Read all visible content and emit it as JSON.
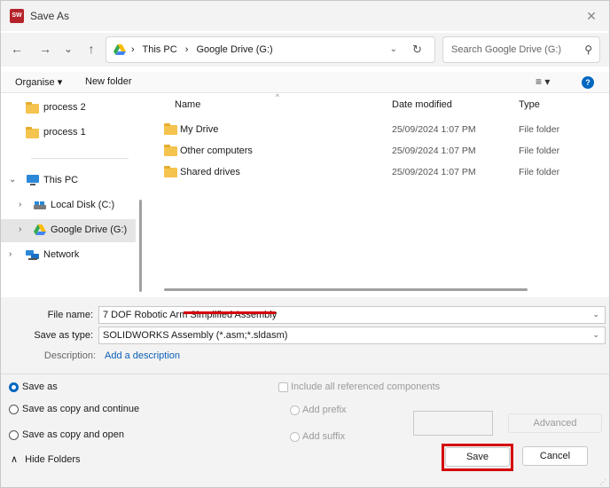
{
  "window": {
    "title": "Save As",
    "close_glyph": "✕",
    "app_icon_text": "SW"
  },
  "nav": {
    "back_glyph": "←",
    "forward_glyph": "→",
    "recent_glyph": "⌄",
    "up_glyph": "↑",
    "breadcrumbs": [
      "This PC",
      "Google Drive (G:)"
    ],
    "separator": "›",
    "dropdown_glyph": "⌄",
    "refresh_glyph": "↻"
  },
  "search": {
    "placeholder": "Search Google Drive (G:)",
    "icon": "search-icon",
    "glyph": "⚲"
  },
  "toolbar": {
    "organise_label": "Organise ▾",
    "new_folder_label": "New folder",
    "view_glyph": "≡ ▾",
    "help_glyph": "?"
  },
  "navpane": {
    "items": [
      {
        "label": "process 2",
        "icon": "folder-icon"
      },
      {
        "label": "process 1",
        "icon": "folder-icon"
      },
      {
        "label": "This PC",
        "icon": "computer-icon",
        "chevron": "⌄"
      },
      {
        "label": "Local Disk (C:)",
        "icon": "drive-icon",
        "chevron": "›"
      },
      {
        "label": "Google Drive (G:)",
        "icon": "google-drive-icon",
        "chevron": "›"
      },
      {
        "label": "Network",
        "icon": "network-icon",
        "chevron": "›"
      }
    ]
  },
  "filelist": {
    "columns": {
      "name": "Name",
      "date": "Date modified",
      "type": "Type"
    },
    "sort_glyph": "^",
    "rows": [
      {
        "name": "My Drive",
        "date": "25/09/2024 1:07 PM",
        "type": "File folder"
      },
      {
        "name": "Other computers",
        "date": "25/09/2024 1:07 PM",
        "type": "File folder"
      },
      {
        "name": "Shared drives",
        "date": "25/09/2024 1:07 PM",
        "type": "File folder"
      }
    ]
  },
  "form": {
    "file_name_label": "File name:",
    "file_name_value": "7 DOF Robotic Arm Simplified Assembly",
    "save_as_type_label": "Save as type:",
    "save_as_type_value": "SOLIDWORKS Assembly (*.asm;*.sldasm)",
    "description_label": "Description:",
    "description_link": "Add a description",
    "dropdown_glyph": "⌄"
  },
  "options": {
    "save_as": "Save as",
    "save_as_copy_continue": "Save as copy and continue",
    "save_as_copy_open": "Save as copy and open",
    "include_referenced": "Include all referenced components",
    "add_prefix": "Add prefix",
    "add_suffix": "Add suffix"
  },
  "buttons": {
    "advanced": "Advanced",
    "save": "Save",
    "cancel": "Cancel",
    "hide_folders": "Hide Folders",
    "hide_folders_glyph": "∧"
  },
  "colors": {
    "accent": "#0067c0",
    "highlight": "#d40000",
    "folder": "#f4c44e"
  }
}
